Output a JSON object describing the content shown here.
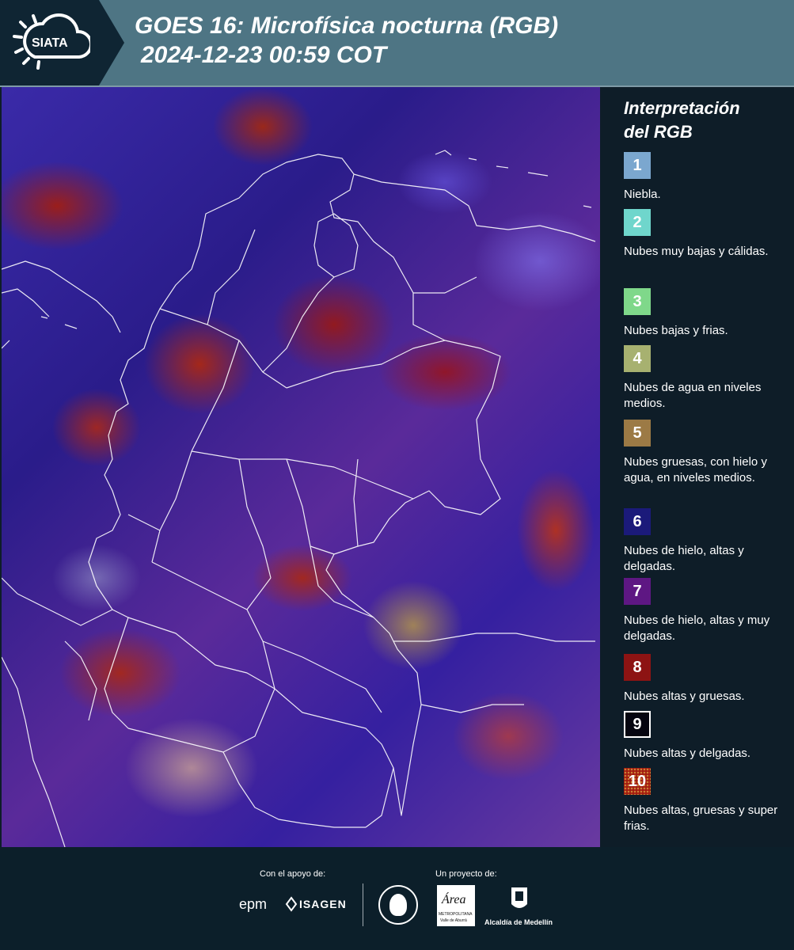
{
  "header": {
    "logo_text": "SIATA",
    "title_line1": "GOES 16: Microfísica nocturna (RGB)",
    "title_line2": "2024-12-23 00:59 COT"
  },
  "legend": {
    "title_line1": "Interpretación",
    "title_line2": "del RGB",
    "items": [
      {
        "num": "1",
        "color": "#7ba7cf",
        "text": "Niebla."
      },
      {
        "num": "2",
        "color": "#6fd6cc",
        "text": "Nubes muy bajas y cálidas."
      },
      {
        "num": "3",
        "color": "#7fd88a",
        "text": "Nubes bajas y frias."
      },
      {
        "num": "4",
        "color": "#a7b170",
        "text": "Nubes de agua en niveles medios."
      },
      {
        "num": "5",
        "color": "#9c7a45",
        "text": "Nubes gruesas, con hielo y agua, en niveles medios."
      },
      {
        "num": "6",
        "color": "#1b1a7a",
        "text": "Nubes de hielo, altas y delgadas."
      },
      {
        "num": "7",
        "color": "#5e1783",
        "text": "Nubes de hielo, altas y muy delgadas."
      },
      {
        "num": "8",
        "color": "#8d1313",
        "text": "Nubes altas y gruesas."
      },
      {
        "num": "9",
        "color": "#050510",
        "text": "Nubes altas y delgadas."
      },
      {
        "num": "10",
        "color": "#a21a10",
        "text": "Nubes altas, gruesas y super frias."
      }
    ]
  },
  "footer": {
    "support_label": "Con el apoyo de:",
    "project_label": "Un proyecto de:",
    "epm_logo": "epm",
    "isagen_logo": "ISAGEN",
    "area_logo": "Área",
    "area_sub": "METROPOLITANA",
    "area_sub2": "Valle de Aburrá",
    "alcaldia": "Alcaldía de Medellín"
  }
}
